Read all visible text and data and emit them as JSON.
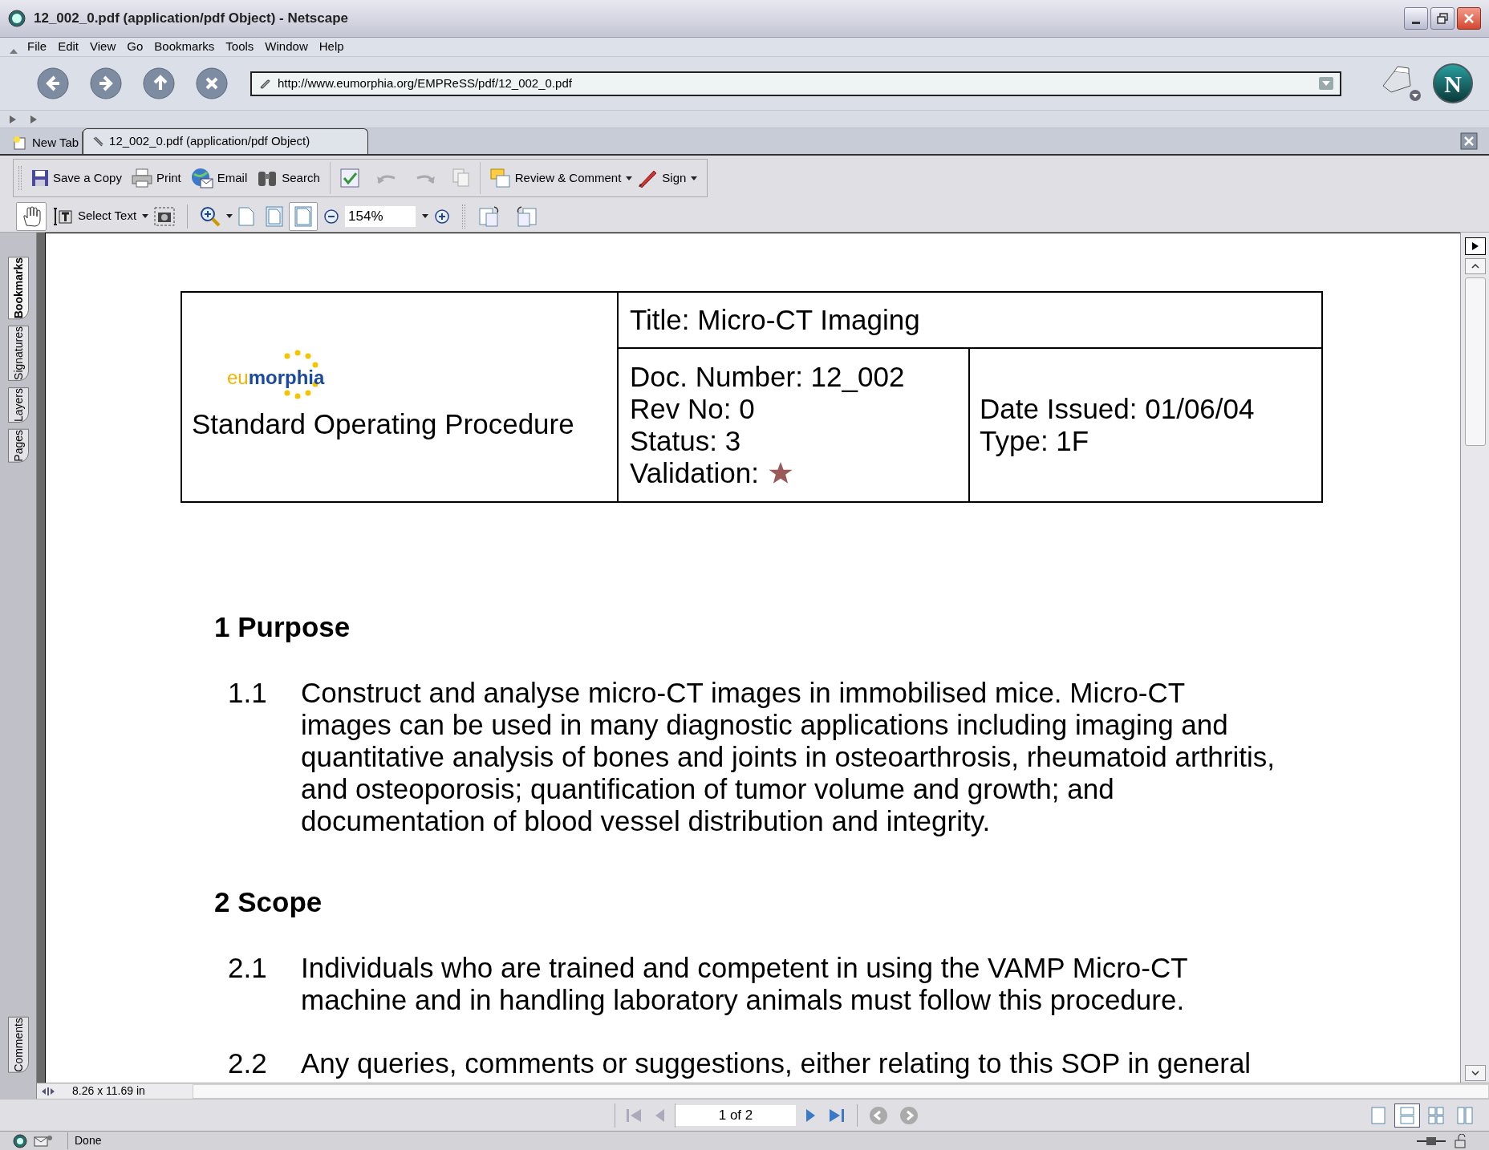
{
  "window": {
    "title": "12_002_0.pdf (application/pdf Object) - Netscape"
  },
  "menu": [
    "File",
    "Edit",
    "View",
    "Go",
    "Bookmarks",
    "Tools",
    "Window",
    "Help"
  ],
  "url": "http://www.eumorphia.org/EMPReSS/pdf/12_002_0.pdf",
  "throbber": {
    "letter": "N"
  },
  "tabs": [
    {
      "label": "New Tab",
      "selected": false
    },
    {
      "label": "12_002_0.pdf (application/pdf Object)",
      "selected": true
    }
  ],
  "toolbar": [
    {
      "kind": "save",
      "label": "Save a Copy"
    },
    {
      "kind": "print",
      "label": "Print"
    },
    {
      "kind": "email",
      "label": "Email"
    },
    {
      "kind": "search",
      "label": "Search"
    },
    {
      "kind": "review",
      "label": "Review & Comment"
    },
    {
      "kind": "sign",
      "label": "Sign"
    }
  ],
  "view_tools": [
    {
      "kind": "hand",
      "selected": true
    },
    {
      "kind": "select",
      "label": "Select Text",
      "selected": false
    },
    {
      "kind": "snapshot",
      "selected": false
    },
    {
      "kind": "zoomtool",
      "selected": false
    },
    {
      "kind": "actual",
      "selected": false
    },
    {
      "kind": "fitpage",
      "selected": false
    },
    {
      "kind": "fitwidth",
      "selected": true
    }
  ],
  "zoom": {
    "value": "154%"
  },
  "side_tabs": [
    {
      "label": "Bookmarks",
      "selected": true
    },
    {
      "label": "Signatures",
      "selected": false
    },
    {
      "label": "Layers",
      "selected": false
    },
    {
      "label": "Pages",
      "selected": false
    },
    {
      "label": "Comments",
      "selected": false
    }
  ],
  "document": {
    "logo": {
      "prefix": "eu",
      "rest": "morphia"
    },
    "header_left": "Standard Operating Procedure",
    "title": "Title: Micro-CT Imaging",
    "middle": [
      "Doc. Number: 12_002",
      "Rev No: 0",
      "Status: 3",
      "Validation:"
    ],
    "right": [
      "Date Issued: 01/06/04",
      "Type: 1F"
    ],
    "sections": [
      {
        "heading": "1 Purpose",
        "paragraphs": [
          {
            "number": "1.1",
            "lines": [
              "Construct and analyse micro-CT images in immobilised mice. Micro-CT",
              "images can be used in many diagnostic applications including imaging and",
              "quantitative analysis of bones and joints in osteoarthrosis, rheumatoid arthritis,",
              "and osteoporosis; quantification of tumor volume and growth; and",
              "documentation of blood vessel distribution and integrity."
            ]
          }
        ]
      },
      {
        "heading": "2 Scope",
        "paragraphs": [
          {
            "number": "2.1",
            "lines": [
              "Individuals who are trained and competent in using the VAMP Micro-CT",
              "machine and in handling laboratory animals must follow this procedure."
            ]
          },
          {
            "number": "2.2",
            "lines": [
              "Any queries, comments or suggestions, either relating to this SOP in general"
            ]
          }
        ]
      }
    ]
  },
  "page_size": "8.26 x 11.69 in",
  "page_nav": {
    "value": "1 of 2"
  },
  "page_layouts": [
    {
      "kind": "single",
      "selected": false
    },
    {
      "kind": "continuous",
      "selected": true
    },
    {
      "kind": "facing",
      "selected": false
    },
    {
      "kind": "facing2",
      "selected": false
    }
  ],
  "status": "Done"
}
